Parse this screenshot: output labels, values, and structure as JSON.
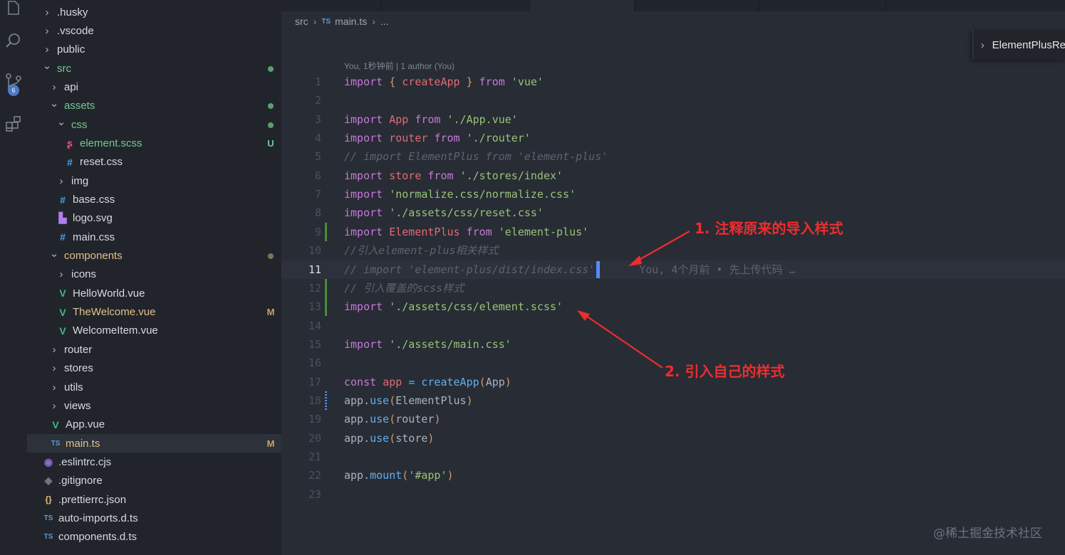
{
  "activity_bar": {
    "items": [
      {
        "icon": "explorer-icon"
      },
      {
        "icon": "search-icon"
      },
      {
        "icon": "source-control-icon",
        "badge": "6"
      },
      {
        "icon": "extensions-icon"
      }
    ]
  },
  "explorer": {
    "rows": [
      {
        "label": ".husky",
        "type": "folder",
        "open": false,
        "depth": 0,
        "color": "#d7dae0"
      },
      {
        "label": ".vscode",
        "type": "folder",
        "open": false,
        "depth": 0,
        "color": "#d7dae0"
      },
      {
        "label": "public",
        "type": "folder",
        "open": false,
        "depth": 0,
        "color": "#d7dae0"
      },
      {
        "label": "src",
        "type": "folder",
        "open": true,
        "depth": 0,
        "color": "#73c991",
        "status": "dot",
        "status_color": "#5f9f6f"
      },
      {
        "label": "api",
        "type": "folder",
        "open": false,
        "depth": 1,
        "color": "#d7dae0"
      },
      {
        "label": "assets",
        "type": "folder",
        "open": true,
        "depth": 1,
        "color": "#73c991",
        "status": "dot",
        "status_color": "#5f9f6f"
      },
      {
        "label": "css",
        "type": "folder",
        "open": true,
        "depth": 2,
        "color": "#73c991",
        "status": "dot",
        "status_color": "#5f9f6f"
      },
      {
        "label": "element.scss",
        "type": "file",
        "icon": "scss-icon",
        "icon_glyph": "ʂ",
        "icon_color": "#f55385",
        "depth": 3,
        "color": "#73c991",
        "status": "U",
        "status_color": "#73c991"
      },
      {
        "label": "reset.css",
        "type": "file",
        "icon": "css-icon",
        "icon_glyph": "#",
        "icon_color": "#42a5f5",
        "depth": 3,
        "color": "#d7dae0"
      },
      {
        "label": "img",
        "type": "folder",
        "open": false,
        "depth": 2,
        "color": "#d7dae0"
      },
      {
        "label": "base.css",
        "type": "file",
        "icon": "css-icon",
        "icon_glyph": "#",
        "icon_color": "#42a5f5",
        "depth": 2,
        "color": "#d7dae0"
      },
      {
        "label": "logo.svg",
        "type": "file",
        "icon": "svg-icon",
        "icon_glyph": "▙",
        "icon_color": "#b07de8",
        "depth": 2,
        "color": "#d7dae0"
      },
      {
        "label": "main.css",
        "type": "file",
        "icon": "css-icon",
        "icon_glyph": "#",
        "icon_color": "#42a5f5",
        "depth": 2,
        "color": "#d7dae0"
      },
      {
        "label": "components",
        "type": "folder",
        "open": true,
        "depth": 1,
        "color": "#e2c08d",
        "status": "dot",
        "status_color": "#7d7557"
      },
      {
        "label": "icons",
        "type": "folder",
        "open": false,
        "depth": 2,
        "color": "#d7dae0"
      },
      {
        "label": "HelloWorld.vue",
        "type": "file",
        "icon": "vue-icon",
        "icon_glyph": "V",
        "icon_color": "#41b883",
        "depth": 2,
        "color": "#d7dae0"
      },
      {
        "label": "TheWelcome.vue",
        "type": "file",
        "icon": "vue-icon",
        "icon_glyph": "V",
        "icon_color": "#41b883",
        "depth": 2,
        "color": "#e2c08d",
        "status": "M",
        "status_color": "#c9a26a"
      },
      {
        "label": "WelcomeItem.vue",
        "type": "file",
        "icon": "vue-icon",
        "icon_glyph": "V",
        "icon_color": "#41b883",
        "depth": 2,
        "color": "#d7dae0"
      },
      {
        "label": "router",
        "type": "folder",
        "open": false,
        "depth": 1,
        "color": "#d7dae0"
      },
      {
        "label": "stores",
        "type": "folder",
        "open": false,
        "depth": 1,
        "color": "#d7dae0"
      },
      {
        "label": "utils",
        "type": "folder",
        "open": false,
        "depth": 1,
        "color": "#d7dae0"
      },
      {
        "label": "views",
        "type": "folder",
        "open": false,
        "depth": 1,
        "color": "#d7dae0"
      },
      {
        "label": "App.vue",
        "type": "file",
        "icon": "vue-icon",
        "icon_glyph": "V",
        "icon_color": "#41b883",
        "depth": 1,
        "color": "#d7dae0"
      },
      {
        "label": "main.ts",
        "type": "file",
        "icon": "ts-icon",
        "icon_glyph": "TS",
        "icon_color": "#5b9bd5",
        "depth": 1,
        "color": "#e2c08d",
        "status": "M",
        "status_color": "#c9a26a",
        "active": true
      },
      {
        "label": ".eslintrc.cjs",
        "type": "file",
        "icon": "eslint-icon",
        "icon_glyph": "◉",
        "icon_color": "#8f6bd6",
        "depth": 0,
        "color": "#d7dae0"
      },
      {
        "label": ".gitignore",
        "type": "file",
        "icon": "git-icon",
        "icon_glyph": "◆",
        "icon_color": "#6e7380",
        "depth": 0,
        "color": "#d7dae0"
      },
      {
        "label": ".prettierrc.json",
        "type": "file",
        "icon": "json-icon",
        "icon_glyph": "{}",
        "icon_color": "#e5c07b",
        "depth": 0,
        "color": "#d7dae0"
      },
      {
        "label": "auto-imports.d.ts",
        "type": "file",
        "icon": "ts-icon",
        "icon_glyph": "TS",
        "icon_color": "#5b9bd5",
        "depth": 0,
        "color": "#d7dae0"
      },
      {
        "label": "components.d.ts",
        "type": "file",
        "icon": "ts-icon",
        "icon_glyph": "TS",
        "icon_color": "#5b9bd5",
        "depth": 0,
        "color": "#d7dae0"
      }
    ]
  },
  "breadcrumb": {
    "folder": "src",
    "file": "main.ts",
    "ellipsis": "..."
  },
  "outline": {
    "label": "ElementPlusRe"
  },
  "codelens": "You, 1秒钟前 | 1 author (You)",
  "code_lines": [
    {
      "n": "1",
      "tokens": [
        [
          "kw",
          "import"
        ],
        [
          "punc",
          " "
        ],
        [
          "brace",
          "{"
        ],
        [
          "punc",
          " "
        ],
        [
          "var",
          "createApp"
        ],
        [
          "punc",
          " "
        ],
        [
          "brace",
          "}"
        ],
        [
          "punc",
          " "
        ],
        [
          "kw",
          "from"
        ],
        [
          "punc",
          " "
        ],
        [
          "str",
          "'vue'"
        ]
      ]
    },
    {
      "n": "2",
      "tokens": []
    },
    {
      "n": "3",
      "tokens": [
        [
          "kw",
          "import"
        ],
        [
          "punc",
          " "
        ],
        [
          "var",
          "App"
        ],
        [
          "punc",
          " "
        ],
        [
          "kw",
          "from"
        ],
        [
          "punc",
          " "
        ],
        [
          "str",
          "'./App.vue'"
        ]
      ]
    },
    {
      "n": "4",
      "tokens": [
        [
          "kw",
          "import"
        ],
        [
          "punc",
          " "
        ],
        [
          "var",
          "router"
        ],
        [
          "punc",
          " "
        ],
        [
          "kw",
          "from"
        ],
        [
          "punc",
          " "
        ],
        [
          "str",
          "'./router'"
        ]
      ]
    },
    {
      "n": "5",
      "tokens": [
        [
          "cm",
          "// import ElementPlus from 'element-plus'"
        ]
      ]
    },
    {
      "n": "6",
      "tokens": [
        [
          "kw",
          "import"
        ],
        [
          "punc",
          " "
        ],
        [
          "var",
          "store"
        ],
        [
          "punc",
          " "
        ],
        [
          "kw",
          "from"
        ],
        [
          "punc",
          " "
        ],
        [
          "str",
          "'./stores/index'"
        ]
      ]
    },
    {
      "n": "7",
      "tokens": [
        [
          "kw",
          "import"
        ],
        [
          "punc",
          " "
        ],
        [
          "str",
          "'normalize.css/normalize.css'"
        ]
      ]
    },
    {
      "n": "8",
      "tokens": [
        [
          "kw",
          "import"
        ],
        [
          "punc",
          " "
        ],
        [
          "str",
          "'./assets/css/reset.css'"
        ]
      ]
    },
    {
      "n": "9",
      "tokens": [
        [
          "kw",
          "import"
        ],
        [
          "punc",
          " "
        ],
        [
          "var",
          "ElementPlus"
        ],
        [
          "punc",
          " "
        ],
        [
          "kw",
          "from"
        ],
        [
          "punc",
          " "
        ],
        [
          "str",
          "'element-plus'"
        ]
      ],
      "gutter": "added"
    },
    {
      "n": "10",
      "tokens": [
        [
          "cm",
          "//引入element-plus相关样式"
        ]
      ]
    },
    {
      "n": "11",
      "tokens": [
        [
          "cm",
          "// import 'element-plus/dist/index.css'"
        ]
      ],
      "current": true,
      "blame": "You, 4个月前 • 先上传代码 …"
    },
    {
      "n": "12",
      "tokens": [
        [
          "cm",
          "// 引入覆盖的scss样式"
        ]
      ],
      "gutter": "added"
    },
    {
      "n": "13",
      "tokens": [
        [
          "kw",
          "import"
        ],
        [
          "punc",
          " "
        ],
        [
          "str",
          "'./assets/css/element.scss'"
        ]
      ],
      "gutter": "added"
    },
    {
      "n": "14",
      "tokens": []
    },
    {
      "n": "15",
      "tokens": [
        [
          "kw",
          "import"
        ],
        [
          "punc",
          " "
        ],
        [
          "str",
          "'./assets/main.css'"
        ]
      ]
    },
    {
      "n": "16",
      "tokens": []
    },
    {
      "n": "17",
      "tokens": [
        [
          "kw",
          "const"
        ],
        [
          "punc",
          " "
        ],
        [
          "var",
          "app"
        ],
        [
          "punc",
          " "
        ],
        [
          "fn",
          "="
        ],
        [
          "punc",
          " "
        ],
        [
          "fn",
          "createApp"
        ],
        [
          "paren",
          "("
        ],
        [
          "punc",
          "App"
        ],
        [
          "paren",
          ")"
        ]
      ]
    },
    {
      "n": "18",
      "tokens": [
        [
          "punc",
          "app"
        ],
        [
          "punc",
          "."
        ],
        [
          "fn",
          "use"
        ],
        [
          "paren",
          "("
        ],
        [
          "punc",
          "ElementPlus"
        ],
        [
          "paren",
          ")"
        ]
      ],
      "gutter": "modified"
    },
    {
      "n": "19",
      "tokens": [
        [
          "punc",
          "app"
        ],
        [
          "punc",
          "."
        ],
        [
          "fn",
          "use"
        ],
        [
          "paren",
          "("
        ],
        [
          "punc",
          "router"
        ],
        [
          "paren",
          ")"
        ]
      ]
    },
    {
      "n": "20",
      "tokens": [
        [
          "punc",
          "app"
        ],
        [
          "punc",
          "."
        ],
        [
          "fn",
          "use"
        ],
        [
          "paren",
          "("
        ],
        [
          "punc",
          "store"
        ],
        [
          "paren",
          ")"
        ]
      ]
    },
    {
      "n": "21",
      "tokens": []
    },
    {
      "n": "22",
      "tokens": [
        [
          "punc",
          "app"
        ],
        [
          "punc",
          "."
        ],
        [
          "fn",
          "mount"
        ],
        [
          "paren",
          "("
        ],
        [
          "str",
          "'#app'"
        ],
        [
          "paren",
          ")"
        ]
      ]
    },
    {
      "n": "23",
      "tokens": []
    }
  ],
  "annotations": {
    "first": "1. 注释原来的导入样式",
    "second": "2. 引入自己的样式"
  },
  "watermark": "@稀土掘金技术社区",
  "colors": {
    "annotation_red": "#ee2d2d",
    "accent_blue": "#528bff"
  }
}
